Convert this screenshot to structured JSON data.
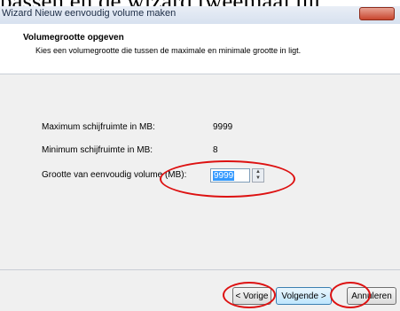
{
  "document_text": "passen en de wizard tweemaal uit",
  "window": {
    "title": "Wizard Nieuw eenvoudig volume maken"
  },
  "header": {
    "title": "Volumegrootte opgeven",
    "subtitle": "Kies een volumegrootte die tussen de maximale en minimale grootte in ligt."
  },
  "fields": {
    "max_label": "Maximum schijfruimte in MB:",
    "max_value": "9999",
    "min_label": "Minimum schijfruimte in MB:",
    "min_value": "8",
    "size_label": "Grootte van eenvoudig volume (MB):",
    "size_value": "9999"
  },
  "buttons": {
    "back": "< Vorige",
    "next": "Volgende >",
    "cancel": "Annuleren"
  },
  "colors": {
    "annotation": "#dd1111",
    "selection": "#3399ff"
  }
}
